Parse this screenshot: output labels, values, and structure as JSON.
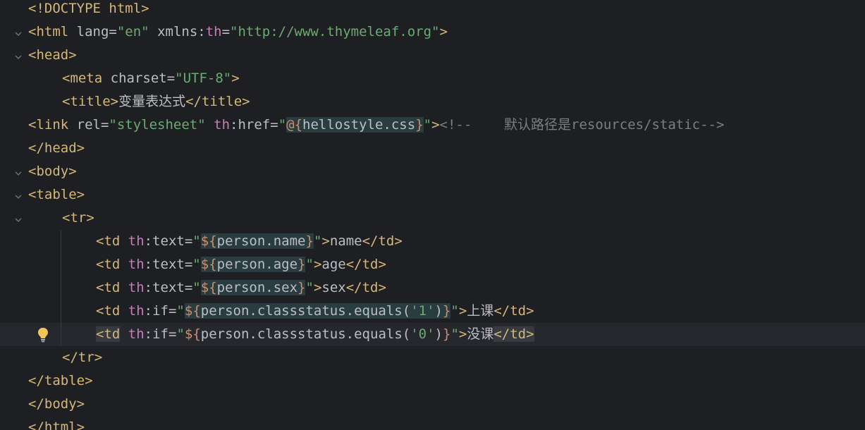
{
  "editor": {
    "lines": [
      {
        "t": "<!DOCTYPE html>"
      },
      {
        "t": "<html lang=\"en\" xmlns:th=\"http://www.thymeleaf.org\">"
      },
      {
        "t": "<head>"
      },
      {
        "t": "    <meta charset=\"UTF-8\">"
      },
      {
        "t": "    <title>变量表达式</title>"
      },
      {
        "t": "<link rel=\"stylesheet\" th:href=\"@{hellostyle.css}\"><!--    默认路径是resources/static-->"
      },
      {
        "t": "</head>"
      },
      {
        "t": "<body>"
      },
      {
        "t": "<table>"
      },
      {
        "t": "    <tr>"
      },
      {
        "t": "        <td th:text=\"${person.name}\">name</td>"
      },
      {
        "t": "        <td th:text=\"${person.age}\">age</td>"
      },
      {
        "t": "        <td th:text=\"${person.sex}\">sex</td>"
      },
      {
        "t": "        <td th:if=\"${person.classstatus.equals('1')}\">上课</td>"
      },
      {
        "t": "        <td th:if=\"${person.classstatus.equals('0')}\">没课</td>"
      },
      {
        "t": "    </tr>"
      },
      {
        "t": "</table>"
      },
      {
        "t": "</body>"
      },
      {
        "t": "</html>"
      }
    ]
  },
  "tokens": {
    "l0": {
      "a": "<!DOCTYPE html>"
    },
    "l1": {
      "a": "<html ",
      "b": "lang",
      "c": "=",
      "d": "\"en\"",
      "e": " xmlns:",
      "f": "th",
      "g": "=",
      "h": "\"http://www.thymeleaf.org\"",
      "i": ">"
    },
    "l2": {
      "a": "<head>"
    },
    "l3": {
      "a": "<meta ",
      "b": "charset",
      "c": "=",
      "d": "\"UTF-8\"",
      "e": ">"
    },
    "l4": {
      "a": "<title>",
      "b": "变量表达式",
      "c": "</title>"
    },
    "l5": {
      "a": "<link ",
      "b": "rel",
      "c": "=",
      "d": "\"stylesheet\"",
      "e": " ",
      "f": "th",
      "g": ":href=",
      "h": "\"",
      "i": "@{",
      "j": "hellostyle.css",
      "k": "}",
      "l": "\"",
      "m": ">",
      "n": "<!--    默认路径是resources/static-->"
    },
    "l6": {
      "a": "</head>"
    },
    "l7": {
      "a": "<body>"
    },
    "l8": {
      "a": "<table>"
    },
    "l9": {
      "a": "<tr>"
    },
    "l10": {
      "a": "<td ",
      "f": "th",
      "g": ":text=",
      "h": "\"",
      "i": "${",
      "j": "person.name",
      "k": "}",
      "l": "\"",
      "m": ">",
      "n": "name",
      "o": "</td>"
    },
    "l11": {
      "a": "<td ",
      "f": "th",
      "g": ":text=",
      "h": "\"",
      "i": "${",
      "j": "person.age",
      "k": "}",
      "l": "\"",
      "m": ">",
      "n": "age",
      "o": "</td>"
    },
    "l12": {
      "a": "<td ",
      "f": "th",
      "g": ":text=",
      "h": "\"",
      "i": "${",
      "j": "person.sex",
      "k": "}",
      "l": "\"",
      "m": ">",
      "n": "sex",
      "o": "</td>"
    },
    "l13": {
      "a": "<td ",
      "f": "th",
      "g": ":if=",
      "h": "\"",
      "i": "${",
      "j": "person.classstatus.equals(",
      "s": "'1'",
      "t": ")",
      "k": "}",
      "l": "\"",
      "m": ">",
      "n": "上课",
      "o": "</td>"
    },
    "l14": {
      "a": "<td",
      "b": " ",
      "f": "th",
      "g": ":if=",
      "h": "\"",
      "i": "${",
      "j": "person.classstatus.equals(",
      "s": "'0'",
      "t": ")",
      "k": "}",
      "l": "\"",
      "m": ">",
      "n": "没课",
      "o": "</td>"
    },
    "l15": {
      "a": "</tr>"
    },
    "l16": {
      "a": "</table>"
    },
    "l17": {
      "a": "</body>"
    },
    "l18": {
      "a": "</html>"
    }
  },
  "icons": {
    "fold": "chevron-down-icon",
    "intention": "lightbulb-icon"
  },
  "colors": {
    "background": "#1e1f22",
    "tag": "#d5b778",
    "string": "#6aab73",
    "namespace": "#c77dbb",
    "expression_delimiter": "#cf8e6d",
    "comment": "#7a7e85"
  }
}
